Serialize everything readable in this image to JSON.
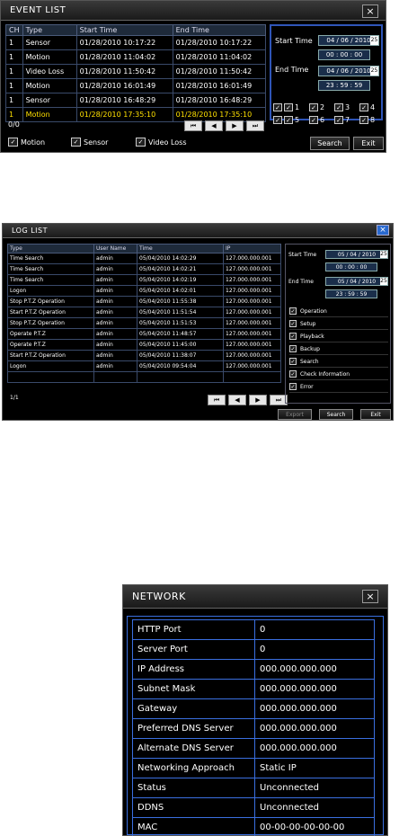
{
  "event_list": {
    "title": "EVENT LIST",
    "close_glyph": "×",
    "columns": [
      "CH",
      "Type",
      "Start Time",
      "End Time"
    ],
    "rows": [
      {
        "ch": "1",
        "type": "Sensor",
        "start": "01/28/2010 10:17:22",
        "end": "01/28/2010 10:17:22"
      },
      {
        "ch": "1",
        "type": "Motion",
        "start": "01/28/2010 11:04:02",
        "end": "01/28/2010 11:04:02"
      },
      {
        "ch": "1",
        "type": "Video Loss",
        "start": "01/28/2010 11:50:42",
        "end": "01/28/2010 11:50:42"
      },
      {
        "ch": "1",
        "type": "Motion",
        "start": "01/28/2010 16:01:49",
        "end": "01/28/2010 16:01:49"
      },
      {
        "ch": "1",
        "type": "Sensor",
        "start": "01/28/2010 16:48:29",
        "end": "01/28/2010 16:48:29"
      },
      {
        "ch": "1",
        "type": "Motion",
        "start": "01/28/2010 17:35:10",
        "end": "01/28/2010 17:35:10"
      }
    ],
    "highlighted_row": 5,
    "page": "0/0",
    "nav": [
      "⏮",
      "◀",
      "▶",
      "⏭"
    ],
    "start_time_label": "Start Time",
    "start_date": "04 / 06 / 2010",
    "start_clock": "00 : 00 : 00",
    "end_time_label": "End Time",
    "end_date": "04 / 06 / 2010",
    "end_clock": "23 : 59 : 59",
    "spin_glyph": "25",
    "channels": [
      "1",
      "2",
      "3",
      "4",
      "5",
      "6",
      "7",
      "8"
    ],
    "check_glyph": "✓",
    "legend": [
      "Motion",
      "Sensor",
      "Video Loss"
    ],
    "search_label": "Search",
    "exit_label": "Exit"
  },
  "log_list": {
    "title": "LOG LIST",
    "close_glyph": "×",
    "columns": [
      "Type",
      "User Name",
      "Time",
      "IP"
    ],
    "rows": [
      {
        "type": "Time Search",
        "user": "admin",
        "time": "05/04/2010 14:02:29",
        "ip": "127.000.000.001"
      },
      {
        "type": "Time Search",
        "user": "admin",
        "time": "05/04/2010 14:02:21",
        "ip": "127.000.000.001"
      },
      {
        "type": "Time Search",
        "user": "admin",
        "time": "05/04/2010 14:02:19",
        "ip": "127.000.000.001"
      },
      {
        "type": "Logon",
        "user": "admin",
        "time": "05/04/2010 14:02:01",
        "ip": "127.000.000.001"
      },
      {
        "type": "Stop P.T.Z Operation",
        "user": "admin",
        "time": "05/04/2010 11:55:38",
        "ip": "127.000.000.001"
      },
      {
        "type": "Start P.T.Z Operation",
        "user": "admin",
        "time": "05/04/2010 11:51:54",
        "ip": "127.000.000.001"
      },
      {
        "type": "Stop P.T.Z Operation",
        "user": "admin",
        "time": "05/04/2010 11:51:53",
        "ip": "127.000.000.001"
      },
      {
        "type": "Operate P.T.Z",
        "user": "admin",
        "time": "05/04/2010 11:48:57",
        "ip": "127.000.000.001"
      },
      {
        "type": "Operate P.T.Z",
        "user": "admin",
        "time": "05/04/2010 11:45:00",
        "ip": "127.000.000.001"
      },
      {
        "type": "Start P.T.Z Operation",
        "user": "admin",
        "time": "05/04/2010 11:38:07",
        "ip": "127.000.000.001"
      },
      {
        "type": "Logon",
        "user": "admin",
        "time": "05/04/2010 09:54:04",
        "ip": "127.000.000.001"
      },
      {
        "type": "",
        "user": "",
        "time": "",
        "ip": ""
      }
    ],
    "page": "1/1",
    "nav": [
      "⏮",
      "◀",
      "▶",
      "⏭"
    ],
    "start_time_label": "Start Time",
    "start_date": "05 / 04 / 2010",
    "start_clock": "00 : 00 : 00",
    "end_time_label": "End Time",
    "end_date": "05 / 04 / 2010",
    "end_clock": "23 : 59 : 59",
    "spin_glyph": "25",
    "options": [
      "Operation",
      "Setup",
      "Playback",
      "Backup",
      "Search",
      "Check Information",
      "Error"
    ],
    "check_glyph": "✓",
    "export_label": "Export",
    "search_label": "Search",
    "exit_label": "Exit"
  },
  "network": {
    "title": "NETWORK",
    "close_glyph": "×",
    "rows": [
      {
        "key": "HTTP Port",
        "value": "0"
      },
      {
        "key": "Server Port",
        "value": "0"
      },
      {
        "key": "IP Address",
        "value": "000.000.000.000"
      },
      {
        "key": "Subnet Mask",
        "value": "000.000.000.000"
      },
      {
        "key": "Gateway",
        "value": "000.000.000.000"
      },
      {
        "key": "Preferred DNS Server",
        "value": "000.000.000.000"
      },
      {
        "key": "Alternate DNS Server",
        "value": "000.000.000.000"
      },
      {
        "key": "Networking Approach",
        "value": "Static IP"
      },
      {
        "key": "Status",
        "value": "Unconnected"
      },
      {
        "key": "DDNS",
        "value": "Unconnected"
      },
      {
        "key": "MAC",
        "value": "00-00-00-00-00-00"
      }
    ]
  }
}
